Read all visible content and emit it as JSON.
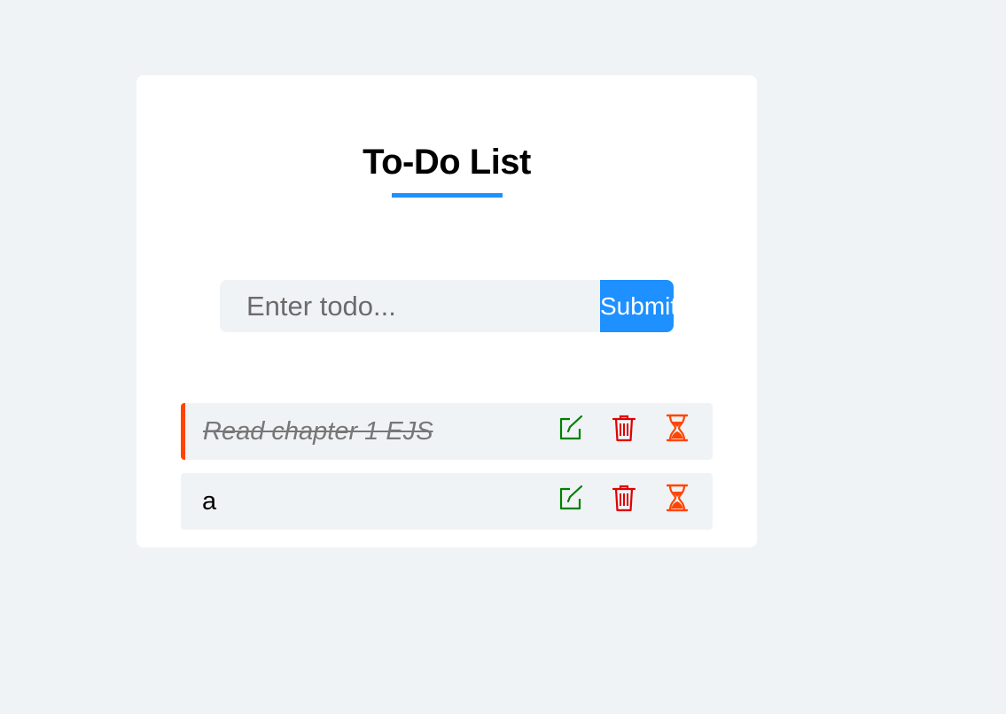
{
  "header": {
    "title": "To-Do List"
  },
  "form": {
    "input_placeholder": "Enter todo...",
    "input_value": "",
    "submit_label": "Submit"
  },
  "todos": [
    {
      "text": "Read chapter  1 EJS",
      "completed": true
    },
    {
      "text": "a",
      "completed": false
    }
  ],
  "icons": {
    "edit": "edit-icon",
    "delete": "trash-icon",
    "pending": "hourglass-icon"
  },
  "colors": {
    "accent": "#1e90ff",
    "background": "#f0f3f6",
    "edit": "#008000",
    "delete": "#e00000",
    "pending": "#ff4500",
    "done_border": "#ff4500"
  }
}
